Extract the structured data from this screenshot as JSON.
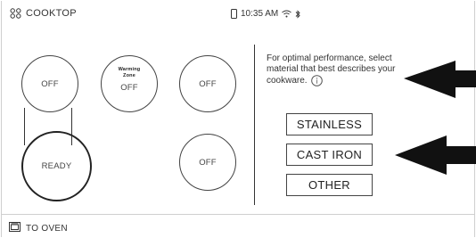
{
  "header": {
    "title": "COOKTOP",
    "time": "10:35 AM"
  },
  "burners": [
    {
      "label": "OFF"
    },
    {
      "label": "OFF",
      "sublabel": "Warming\nZone"
    },
    {
      "label": "OFF"
    },
    {
      "label": "READY"
    },
    {
      "label": "OFF"
    }
  ],
  "prompt": {
    "text": "For optimal performance, select material that best describes your cookware."
  },
  "materials": [
    "STAINLESS",
    "CAST IRON",
    "OTHER"
  ],
  "footer": {
    "to_oven_label": "TO OVEN"
  }
}
